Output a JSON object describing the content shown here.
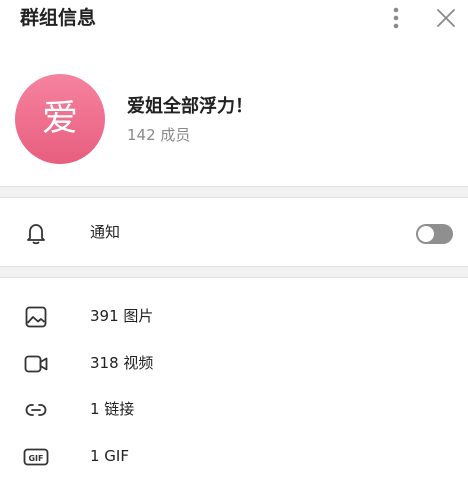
{
  "header": {
    "title": "群组信息"
  },
  "profile": {
    "avatar_text": "爱",
    "name": "爱姐全部浮力！",
    "members": "142 成员"
  },
  "notifications": {
    "label": "通知",
    "enabled": false
  },
  "media": {
    "items": [
      {
        "icon": "image-icon",
        "label": "391 图片"
      },
      {
        "icon": "video-icon",
        "label": "318 视频"
      },
      {
        "icon": "link-icon",
        "label": "1 链接"
      },
      {
        "icon": "gif-icon",
        "label": "1 GIF"
      }
    ]
  },
  "colors": {
    "avatar_top": "#f5839f",
    "avatar_bottom": "#e85e7f",
    "toggle_off": "#8f8f8f"
  }
}
